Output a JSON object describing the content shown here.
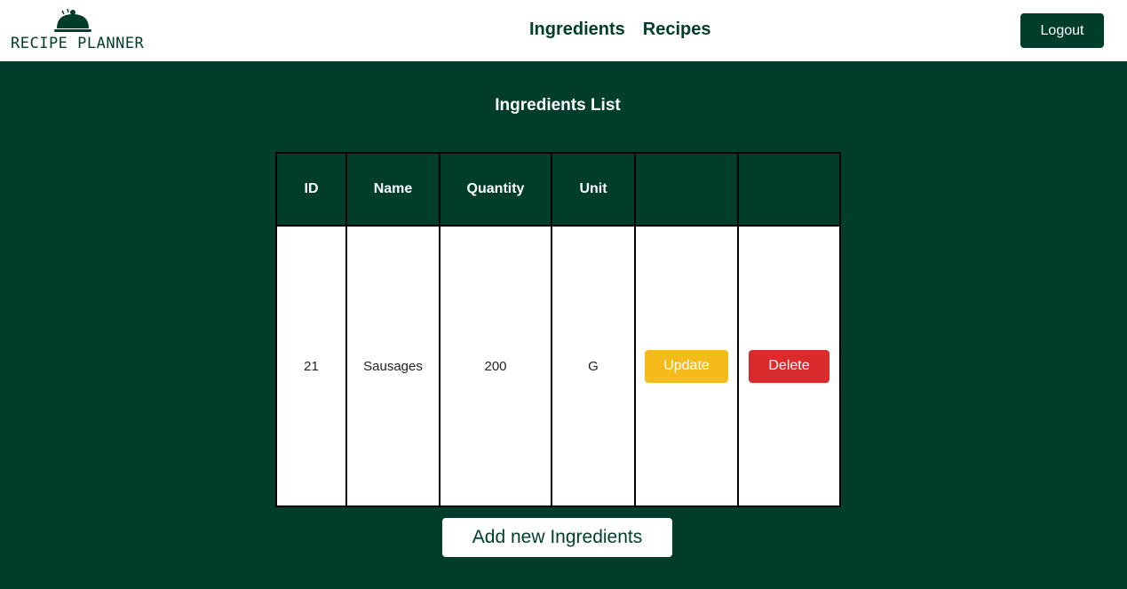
{
  "navbar": {
    "logo_text": "RECIPE PLANNER",
    "links": [
      {
        "label": "Ingredients"
      },
      {
        "label": "Recipes"
      }
    ],
    "logout_label": "Logout"
  },
  "main": {
    "title": "Ingredients List",
    "table": {
      "headers": [
        "ID",
        "Name",
        "Quantity",
        "Unit",
        "",
        ""
      ],
      "rows": [
        {
          "id": "21",
          "name": "Sausages",
          "quantity": "200",
          "unit": "G",
          "update_label": "Update",
          "delete_label": "Delete"
        }
      ]
    },
    "add_button_label": "Add new Ingredients"
  },
  "colors": {
    "primary": "#003d2a",
    "update": "#f5bb1b",
    "delete": "#d92b2b",
    "white": "#ffffff"
  }
}
